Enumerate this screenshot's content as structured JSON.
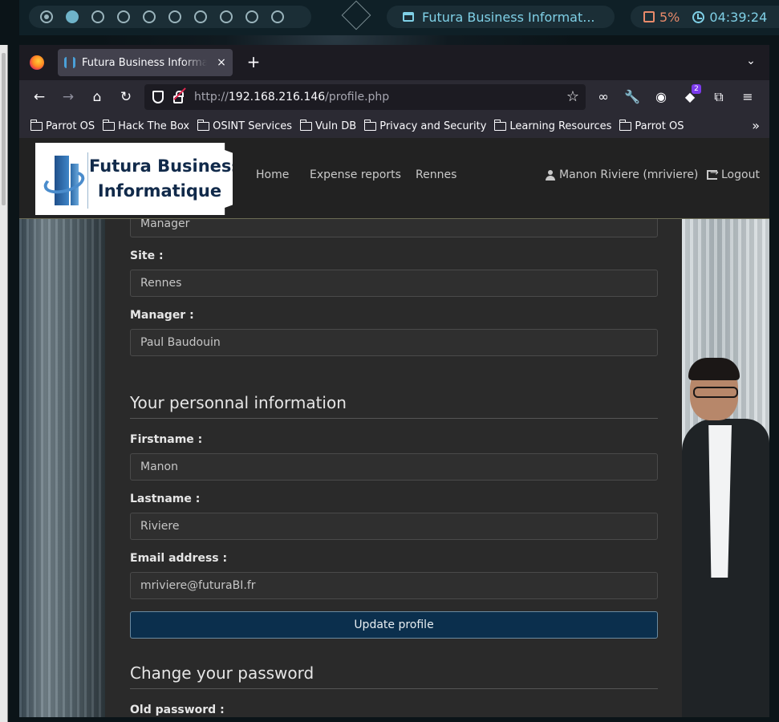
{
  "panel": {
    "workspaces": [
      "1",
      "2",
      "3",
      "4",
      "5",
      "6",
      "7",
      "8",
      "9",
      "10"
    ],
    "window_title": "Futura Business Informat...",
    "cpu": "5%",
    "clock": "04:39:24"
  },
  "browser": {
    "tab_title": "Futura Business Informatique",
    "tab_close": "×",
    "new_tab": "+",
    "url_scheme": "http://",
    "url_host": "192.168.216.146",
    "url_path": "/profile.php",
    "bookmarks": [
      "Parrot OS",
      "Hack The Box",
      "OSINT Services",
      "Vuln DB",
      "Privacy and Security",
      "Learning Resources",
      "Parrot OS"
    ],
    "extension_badge": "2"
  },
  "site": {
    "logo_line1": "Futura Business",
    "logo_line2": "Informatique",
    "nav": [
      "Home",
      "Expense reports",
      "Rennes"
    ],
    "user": "Manon Riviere (mriviere)",
    "logout": "Logout"
  },
  "form": {
    "role_value": "Manager",
    "site_label": "Site :",
    "site_value": "Rennes",
    "manager_label": "Manager :",
    "manager_value": "Paul Baudouin",
    "personal_title": "Your personnal information",
    "firstname_label": "Firstname :",
    "firstname_value": "Manon",
    "lastname_label": "Lastname :",
    "lastname_value": "Riviere",
    "email_label": "Email address :",
    "email_value": "mriviere@futuraBI.fr",
    "update_button": "Update profile",
    "password_title": "Change your password",
    "old_password_label": "Old password :"
  }
}
